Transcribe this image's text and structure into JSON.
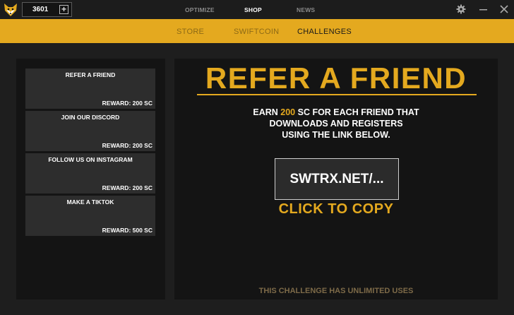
{
  "titlebar": {
    "logo": "fox-logo",
    "balance": "3601",
    "add_icon": "plus-icon",
    "nav": [
      {
        "label": "OPTIMIZE"
      },
      {
        "label": "SHOP"
      },
      {
        "label": "NEWS"
      }
    ],
    "active_nav": "SHOP",
    "window_icons": [
      "gear-icon",
      "minimize-icon",
      "close-icon"
    ]
  },
  "subnav": {
    "items": [
      {
        "label": "STORE"
      },
      {
        "label": "SWIFTCOIN"
      },
      {
        "label": "CHALLENGES"
      }
    ],
    "active": "CHALLENGES"
  },
  "challenges": [
    {
      "title": "REFER A FRIEND",
      "reward": "REWARD: 200 SC"
    },
    {
      "title": "JOIN OUR DISCORD",
      "reward": "REWARD: 200 SC"
    },
    {
      "title": "FOLLOW US ON INSTAGRAM",
      "reward": "REWARD: 200 SC"
    },
    {
      "title": "MAKE A TIKTOK",
      "reward": "REWARD: 500 SC"
    }
  ],
  "detail": {
    "title": "REFER A FRIEND",
    "desc_prefix": "EARN ",
    "desc_amount": "200",
    "desc_line1_suffix": " SC FOR EACH FRIEND THAT",
    "desc_line2": "DOWNLOADS AND REGISTERS",
    "desc_line3": "USING THE LINK BELOW.",
    "link": "SWTRX.NET/...",
    "copy_label": "CLICK TO COPY",
    "footer": "THIS CHALLENGE HAS UNLIMITED USES"
  },
  "colors": {
    "accent": "#e4a91f",
    "background": "#1e1e1e",
    "panel": "#141414",
    "card": "#2d2d2d"
  }
}
